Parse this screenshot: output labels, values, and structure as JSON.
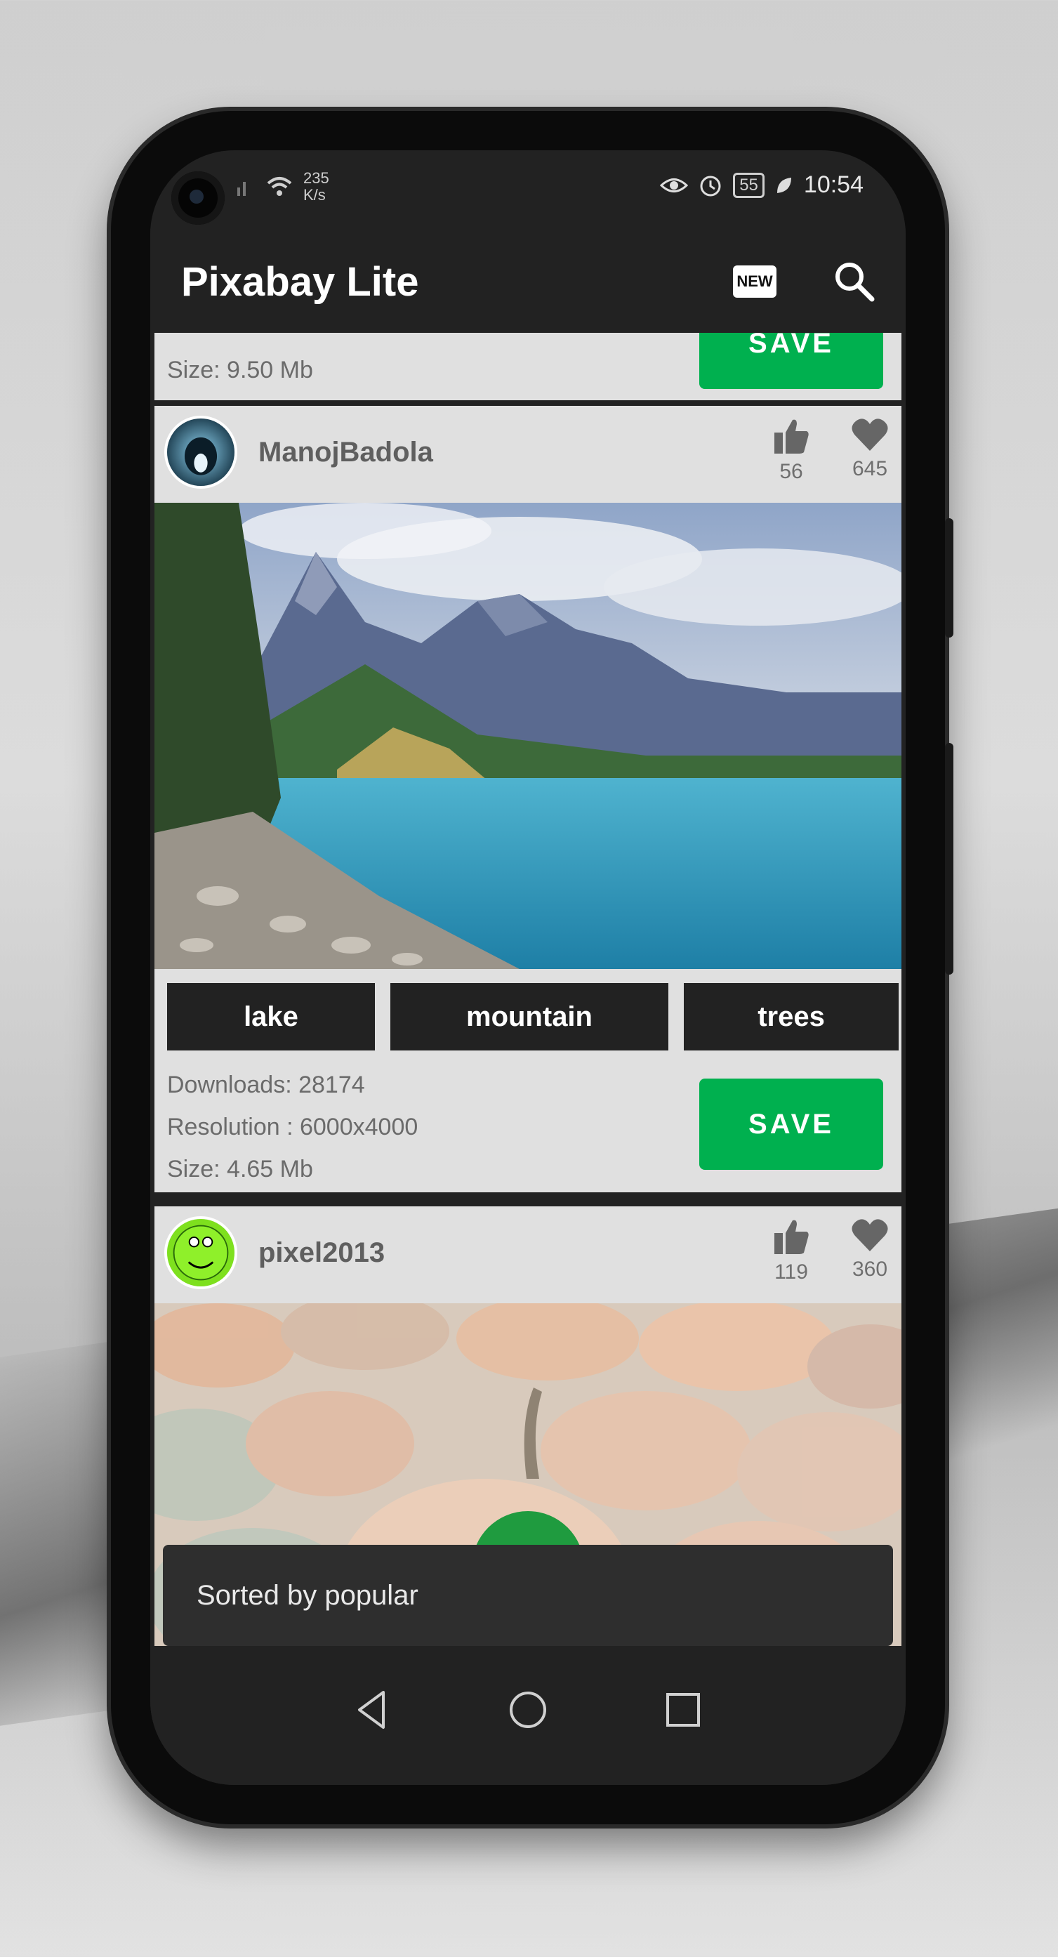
{
  "status_bar": {
    "net_speed": "235",
    "net_unit": "K/s",
    "battery": "55",
    "time": "10:54"
  },
  "app_bar": {
    "title": "Pixabay Lite",
    "new_badge": "NEW"
  },
  "cards": [
    {
      "partial": true,
      "size": "Size: 9.50 Mb",
      "save_label": "SAVE"
    },
    {
      "user": "ManojBadola",
      "likes": "56",
      "favorites": "645",
      "tags": [
        "lake",
        "mountain",
        "trees"
      ],
      "downloads": "Downloads: 28174",
      "resolution": "Resolution : 6000x4000",
      "size": "Size: 4.65 Mb",
      "save_label": "SAVE"
    },
    {
      "user": "pixel2013",
      "likes": "119",
      "favorites": "360"
    }
  ],
  "snackbar": {
    "message": "Sorted by popular"
  },
  "colors": {
    "save_green": "#00b04f",
    "card_bg": "#e0e0e0",
    "app_bg": "#222222"
  },
  "icons": [
    "search-icon",
    "new-icon",
    "thumbs-up-icon",
    "heart-icon",
    "back-icon",
    "home-icon",
    "recents-icon"
  ]
}
